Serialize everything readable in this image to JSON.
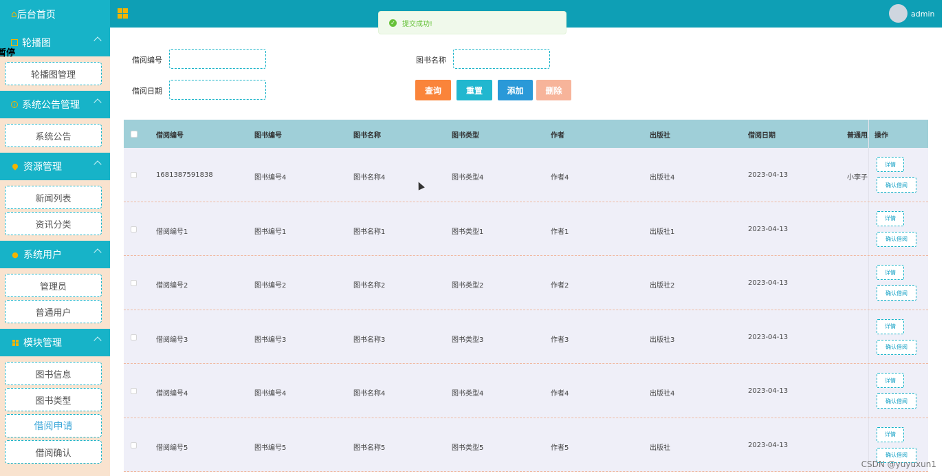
{
  "sidebar": {
    "home_label": "后台首页",
    "overlay_text": "暂停",
    "groups": [
      {
        "title": "轮播图",
        "items": [
          "轮播图管理"
        ]
      },
      {
        "title": "系统公告管理",
        "items": [
          "系统公告"
        ]
      },
      {
        "title": "资源管理",
        "items": [
          "新闻列表",
          "资讯分类"
        ]
      },
      {
        "title": "系统用户",
        "items": [
          "管理员",
          "普通用户"
        ]
      },
      {
        "title": "模块管理",
        "items": [
          "图书信息",
          "图书类型",
          "借阅申请",
          "借阅确认"
        ]
      }
    ],
    "active_item": "借阅申请"
  },
  "topbar": {
    "user_name": "admin"
  },
  "toast": {
    "message": "提交成功!"
  },
  "search_form": {
    "borrow_no_label": "借阅编号",
    "book_name_label": "图书名称",
    "borrow_date_label": "借阅日期",
    "borrow_no_value": "",
    "book_name_value": "",
    "borrow_date_value": ""
  },
  "buttons": {
    "query": "查询",
    "reset": "重置",
    "add": "添加",
    "delete": "删除"
  },
  "colors": {
    "primary": "#17b3c8",
    "query": "#fa843a",
    "reset": "#21b7cf",
    "add": "#2a99d8",
    "delete": "#f7b49a"
  },
  "table": {
    "headers": [
      "借阅编号",
      "图书编号",
      "图书名称",
      "图书类型",
      "作者",
      "出版社",
      "借阅日期",
      "普通用户",
      "操作"
    ],
    "rows": [
      [
        "1681387591838",
        "图书编号4",
        "图书名称4",
        "图书类型4",
        "作者4",
        "出版社4",
        "2023-04-13",
        "小李子"
      ],
      [
        "借阅编号1",
        "图书编号1",
        "图书名称1",
        "图书类型1",
        "作者1",
        "出版社1",
        "2023-04-13",
        ""
      ],
      [
        "借阅编号2",
        "图书编号2",
        "图书名称2",
        "图书类型2",
        "作者2",
        "出版社2",
        "2023-04-13",
        ""
      ],
      [
        "借阅编号3",
        "图书编号3",
        "图书名称3",
        "图书类型3",
        "作者3",
        "出版社3",
        "2023-04-13",
        ""
      ],
      [
        "借阅编号4",
        "图书编号4",
        "图书名称4",
        "图书类型4",
        "作者4",
        "出版社4",
        "2023-04-13",
        ""
      ],
      [
        "借阅编号5",
        "图书编号5",
        "图书名称5",
        "图书类型5",
        "作者5",
        "出版社",
        "2023-04-13",
        ""
      ]
    ],
    "row_actions": {
      "detail": "详情",
      "confirm": "确认借阅"
    }
  },
  "watermark": "CSDN @yuyuxun1"
}
